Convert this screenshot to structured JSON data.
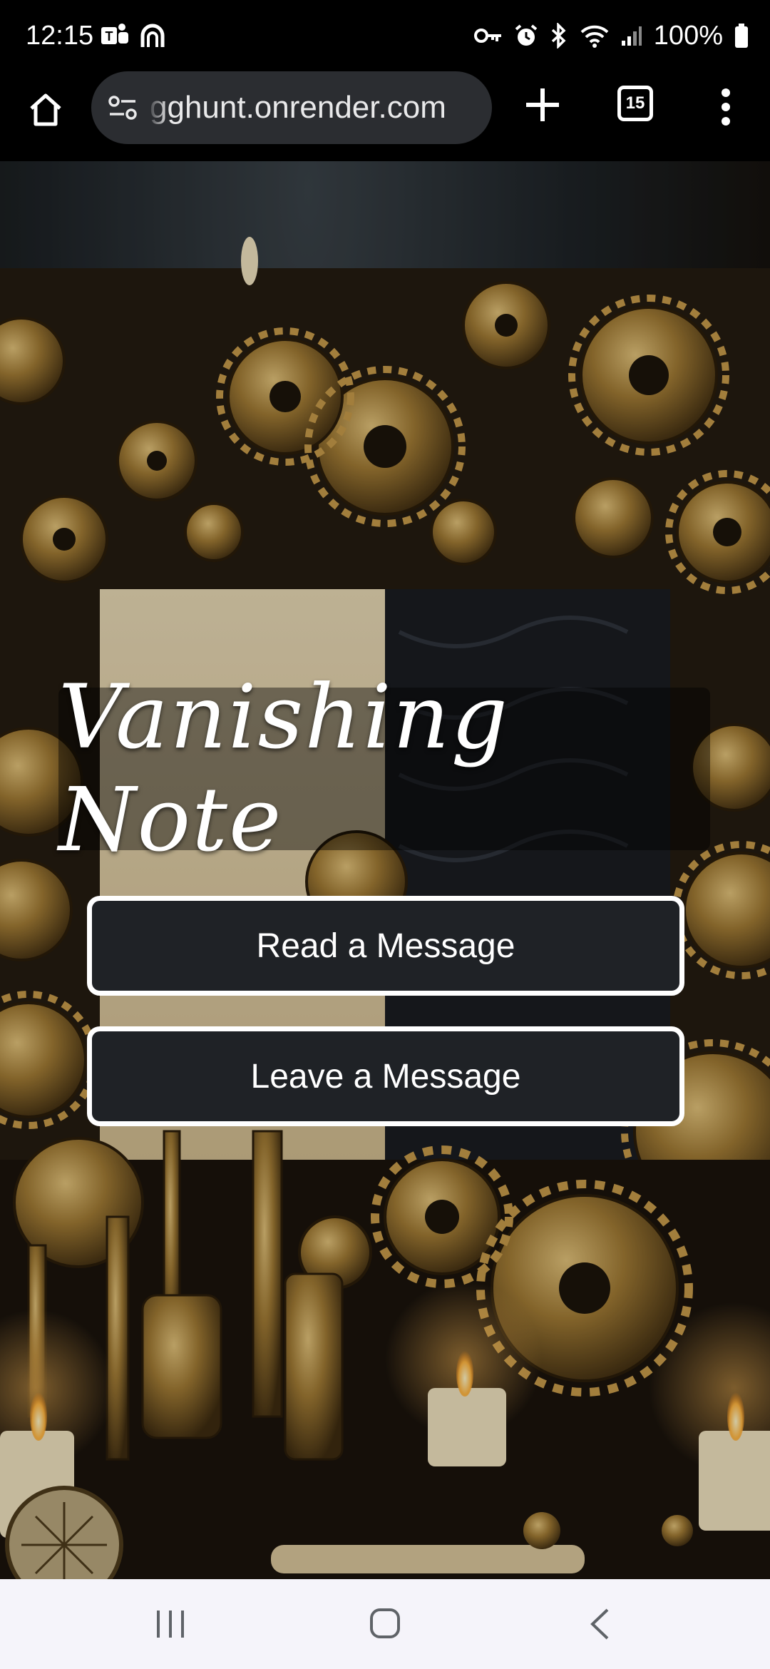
{
  "status_bar": {
    "time": "12:15",
    "battery": "100%",
    "left_icons": [
      "teams-icon",
      "arch-app-icon"
    ],
    "right_icons": [
      "vpn-key-icon",
      "alarm-icon",
      "bluetooth-icon",
      "wifi-icon",
      "signal-icon",
      "battery-icon"
    ]
  },
  "browser": {
    "url": "gghunt.onrender.com",
    "tab_count": "15",
    "icons": [
      "home-icon",
      "site-settings-icon",
      "plus-icon",
      "tab-switcher-icon",
      "more-vert-icon"
    ]
  },
  "page": {
    "title": "Vanishing Note",
    "buttons": {
      "read": "Read a Message",
      "leave": "Leave a Message"
    },
    "colors": {
      "button_bg": "#1f2226",
      "button_border": "#ffffff",
      "title_band": "rgba(0,0,0,0.42)",
      "bronze": "#8a6a2e"
    }
  },
  "nav_bar": {
    "icons": [
      "recents-icon",
      "home-icon",
      "back-icon"
    ]
  }
}
